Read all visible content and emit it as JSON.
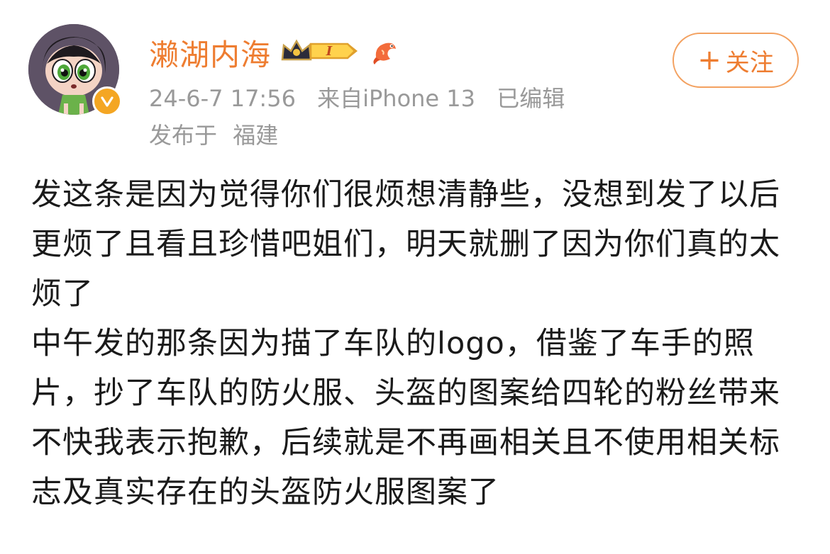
{
  "header": {
    "username": "濑湖内海",
    "level_badge": "I",
    "timestamp": "24-6-7 17:56",
    "source": "来自iPhone 13",
    "edited": "已编辑",
    "location_prefix": "发布于",
    "location": "福建",
    "follow_plus": "+",
    "follow_label": "关注"
  },
  "post": {
    "paragraphs": [
      "发这条是因为觉得你们很烦想清静些，没想到发了以后更烦了且看且珍惜吧姐们，明天就删了因为你们真的太烦了",
      "中午发的那条因为描了车队的logo，借鉴了车手的照片，抄了车队的防火服、头盔的图案给四轮的粉丝带来不快我表示抱歉，后续就是不再画相关且不使用相关标志及真实存在的头盔防火服图案了"
    ]
  },
  "colors": {
    "accent": "#ee7d31",
    "meta_text": "#999999",
    "body_text": "#1a1a1a",
    "verified_badge": "#f4a623"
  },
  "icons": [
    "avatar",
    "verified-icon",
    "crown-vip-icon",
    "level-badge-icon",
    "koi-fish-icon"
  ]
}
